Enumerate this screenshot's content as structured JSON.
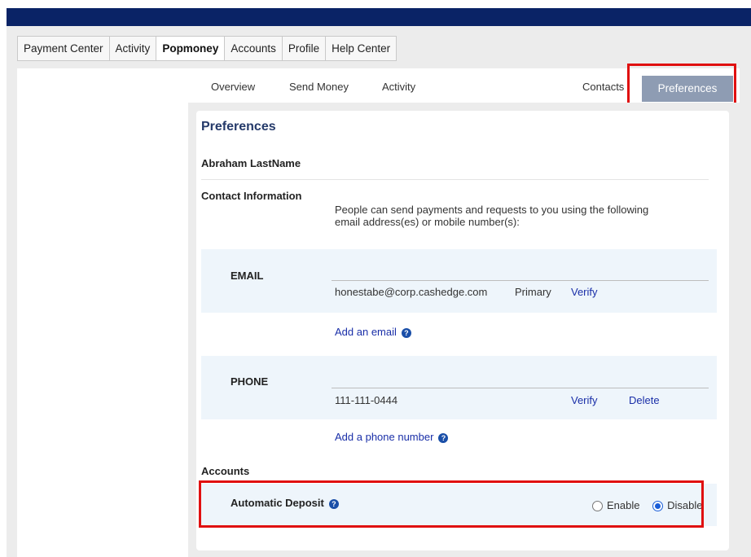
{
  "nav": {
    "tabs": [
      {
        "label": "Payment Center"
      },
      {
        "label": "Activity"
      },
      {
        "label": "Popmoney"
      },
      {
        "label": "Accounts"
      },
      {
        "label": "Profile"
      },
      {
        "label": "Help Center"
      }
    ]
  },
  "subnav": {
    "overview": "Overview",
    "send_money": "Send Money",
    "activity": "Activity",
    "contacts": "Contacts",
    "preferences": "Preferences"
  },
  "page": {
    "title": "Preferences",
    "user_name": "Abraham LastName",
    "contact_info_label": "Contact Information",
    "contact_info_desc": "People can send payments and requests to you using the following email address(es) or mobile number(s):"
  },
  "email": {
    "label": "EMAIL",
    "address": "honestabe@corp.cashedge.com",
    "status": "Primary",
    "verify": "Verify",
    "add_link": "Add an email"
  },
  "phone": {
    "label": "PHONE",
    "number": "111-111-0444",
    "verify": "Verify",
    "delete": "Delete",
    "add_link": "Add a phone number"
  },
  "accounts": {
    "label": "Accounts",
    "auto_deposit_label": "Automatic Deposit",
    "enable": "Enable",
    "disable": "Disable",
    "selected": "Disable"
  },
  "colors": {
    "header_navy": "#0a2366",
    "link_blue": "#1a2fa8",
    "highlight_red": "#e01010",
    "pref_button": "#8e9cb3"
  }
}
